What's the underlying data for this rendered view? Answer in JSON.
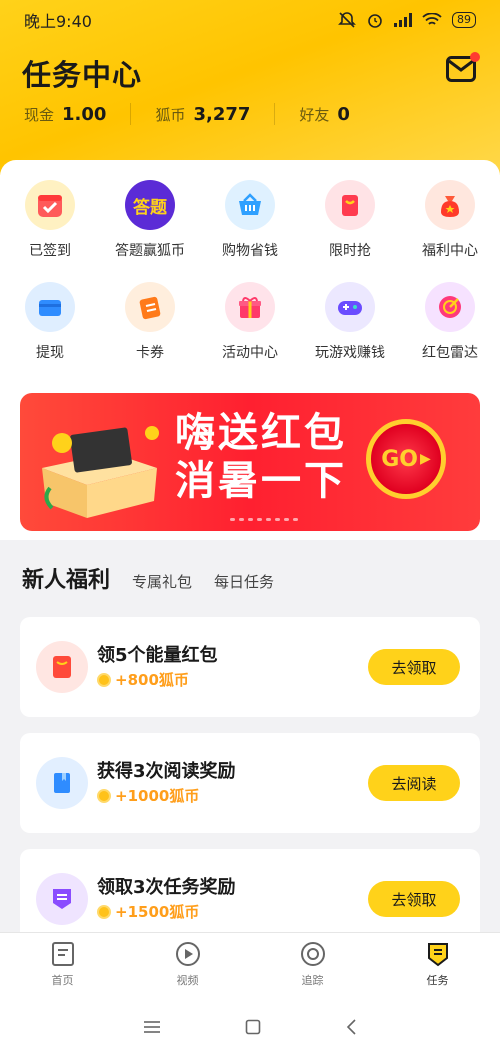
{
  "status_bar": {
    "time": "晚上9:40",
    "battery": "89"
  },
  "header": {
    "title": "任务中心",
    "stats": [
      {
        "label": "现金",
        "value": "1.00"
      },
      {
        "label": "狐币",
        "value": "3,277"
      },
      {
        "label": "好友",
        "value": "0"
      }
    ]
  },
  "grid": [
    {
      "label": "已签到",
      "icon": "calendar-check-icon",
      "bg": "#fff1c2"
    },
    {
      "label": "答题赢狐币",
      "icon": "quiz-icon",
      "bg": "#f0e8ff",
      "badge": "答题"
    },
    {
      "label": "购物省钱",
      "icon": "basket-icon",
      "bg": "#dff1ff"
    },
    {
      "label": "限时抢",
      "icon": "gift-bag-icon",
      "bg": "#ffe3e6"
    },
    {
      "label": "福利中心",
      "icon": "lucky-bag-icon",
      "bg": "#ffe7de"
    },
    {
      "label": "提现",
      "icon": "wallet-icon",
      "bg": "#dfeeff"
    },
    {
      "label": "卡券",
      "icon": "ticket-icon",
      "bg": "#ffeedd"
    },
    {
      "label": "活动中心",
      "icon": "gift-box-icon",
      "bg": "#ffe3ea"
    },
    {
      "label": "玩游戏赚钱",
      "icon": "gamepad-icon",
      "bg": "#ece8ff"
    },
    {
      "label": "红包雷达",
      "icon": "radar-icon",
      "bg": "#f6e2ff"
    }
  ],
  "banner": {
    "line1": "嗨送红包",
    "line2": "消暑一下",
    "go": "GO"
  },
  "section": {
    "active": "新人福利",
    "tab2": "专属礼包",
    "tab3": "每日任务"
  },
  "tasks": [
    {
      "title": "领5个能量红包",
      "reward": "+800狐币",
      "button": "去领取",
      "icon": "red-envelope-icon"
    },
    {
      "title": "获得3次阅读奖励",
      "reward": "+1000狐币",
      "button": "去阅读",
      "icon": "book-icon"
    },
    {
      "title": "领取3次任务奖励",
      "reward": "+1500狐币",
      "button": "去领取",
      "icon": "task-badge-icon"
    }
  ],
  "nav": [
    {
      "label": "首页",
      "icon": "home-doc-icon"
    },
    {
      "label": "视频",
      "icon": "play-icon"
    },
    {
      "label": "追踪",
      "icon": "track-icon"
    },
    {
      "label": "任务",
      "icon": "task-shield-icon",
      "active": true
    }
  ],
  "colors": {
    "accent": "#ffd21a",
    "reward": "#ff9e1b",
    "banner": "#ff2030"
  }
}
